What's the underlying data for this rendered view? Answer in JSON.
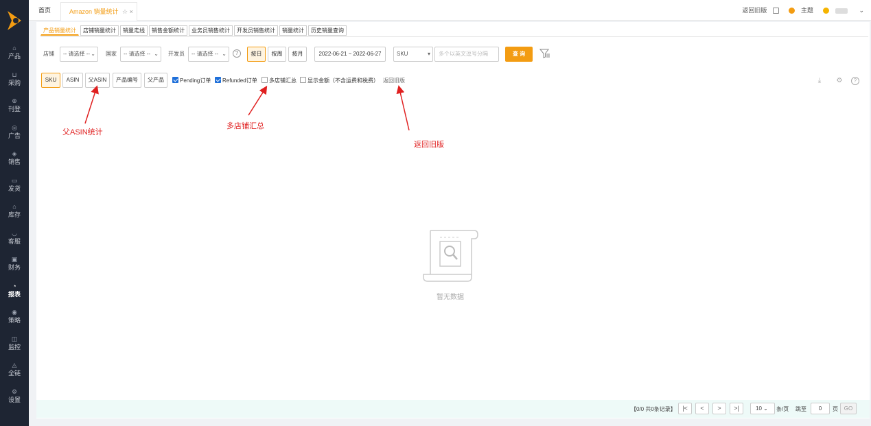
{
  "sidebar": {
    "items": [
      {
        "label": "产品",
        "icon": "box-icon"
      },
      {
        "label": "采购",
        "icon": "cart-icon"
      },
      {
        "label": "刊登",
        "icon": "publish-icon"
      },
      {
        "label": "广告",
        "icon": "ad-icon"
      },
      {
        "label": "销售",
        "icon": "sales-icon"
      },
      {
        "label": "发货",
        "icon": "shipping-icon"
      },
      {
        "label": "库存",
        "icon": "warehouse-icon"
      },
      {
        "label": "客服",
        "icon": "headset-icon"
      },
      {
        "label": "财务",
        "icon": "finance-icon"
      },
      {
        "label": "报表",
        "icon": "report-icon",
        "active": true
      },
      {
        "label": "策略",
        "icon": "strategy-icon"
      },
      {
        "label": "监控",
        "icon": "monitor-icon"
      },
      {
        "label": "全链",
        "icon": "chain-icon"
      },
      {
        "label": "设置",
        "icon": "settings-icon"
      }
    ]
  },
  "topbar": {
    "home_tab": "首页",
    "active_tab": "Amazon 销量统计",
    "back_old": "返回旧版",
    "theme": "主题"
  },
  "subtabs": [
    "产品销量统计",
    "店铺销量统计",
    "销量走线",
    "销售金额统计",
    "业务员销售统计",
    "开发员销售统计",
    "销量统计",
    "历史销量查询"
  ],
  "filters": {
    "shop_label": "店铺",
    "shop_value": "-- 请选择 --",
    "country_label": "国家",
    "country_value": "-- 请选择 --",
    "developer_label": "开发员",
    "developer_value": "-- 请选择 --",
    "period_day": "按日",
    "period_week": "按周",
    "period_month": "按月",
    "date_range": "2022-06-21 ~ 2022-06-27",
    "search_type": "SKU",
    "search_placeholder": "多个以英文逗号分隔",
    "query": "查 询"
  },
  "options": {
    "buttons": [
      "SKU",
      "ASIN",
      "父ASIN",
      "产品编号",
      "父产品"
    ],
    "pending": "Pending订单",
    "refunded": "Refunded订单",
    "multi_shop": "多店铺汇总",
    "show_amount": "显示金额（不含运费和税费）",
    "back_old": "返回旧版"
  },
  "annotations": {
    "parent_asin": "父ASIN统计",
    "multi_shop": "多店铺汇总",
    "back_old": "返回旧版"
  },
  "empty": {
    "text": "暂无数据"
  },
  "pager": {
    "info": "【0/0  共0条记录】",
    "page_size": "10",
    "per_page": "条/页",
    "jump_to": "跳至",
    "page_input": "0",
    "page_unit": "页",
    "go": "GO"
  },
  "colors": {
    "accent": "#f39c12",
    "sidebar": "#1e2533",
    "annotation": "#e02020",
    "checkbox": "#1e6fd9"
  }
}
